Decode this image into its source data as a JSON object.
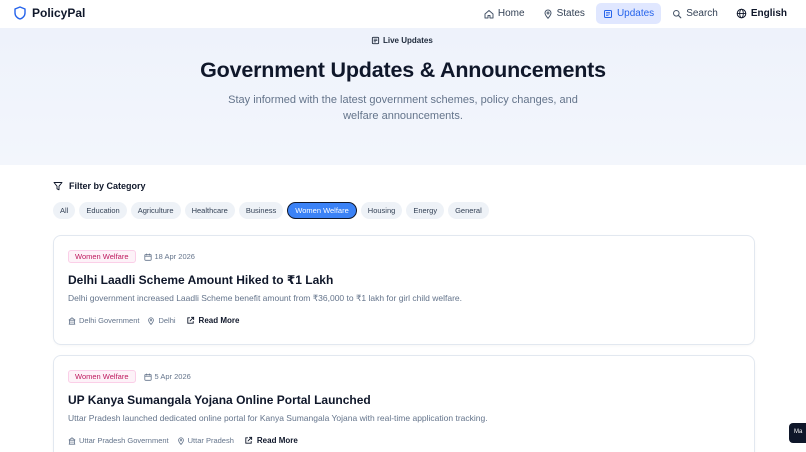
{
  "nav": {
    "brand": "PolicyPal",
    "links": [
      {
        "label": "Home",
        "icon": "home-icon"
      },
      {
        "label": "States",
        "icon": "map-pin-icon"
      },
      {
        "label": "Updates",
        "icon": "newspaper-icon",
        "active": true
      },
      {
        "label": "Search",
        "icon": "search-icon"
      }
    ],
    "language": "English"
  },
  "hero": {
    "badge": "Live Updates",
    "title": "Government Updates & Announcements",
    "subtitle": "Stay informed with the latest government schemes, policy changes, and welfare announcements."
  },
  "filter": {
    "heading": "Filter by Category",
    "categories": [
      "All",
      "Education",
      "Agriculture",
      "Healthcare",
      "Business",
      "Women Welfare",
      "Housing",
      "Energy",
      "General"
    ],
    "selected": "Women Welfare"
  },
  "updates": [
    {
      "category": "Women Welfare",
      "date": "18 Apr 2026",
      "title": "Delhi Laadli Scheme Amount Hiked to ₹1 Lakh",
      "description": "Delhi government increased Laadli Scheme benefit amount from ₹36,000 to ₹1 lakh for girl child welfare.",
      "source": "Delhi Government",
      "location": "Delhi",
      "link_label": "Read More"
    },
    {
      "category": "Women Welfare",
      "date": "5 Apr 2026",
      "title": "UP Kanya Sumangala Yojana Online Portal Launched",
      "description": "Uttar Pradesh launched dedicated online portal for Kanya Sumangala Yojana with real-time application tracking.",
      "source": "Uttar Pradesh Government",
      "location": "Uttar Pradesh",
      "link_label": "Read More"
    }
  ],
  "chat_button": "Ma",
  "colors": {
    "accent": "#3b82f6",
    "tag_text": "#be185d",
    "tag_bg": "#fdf2f8"
  }
}
